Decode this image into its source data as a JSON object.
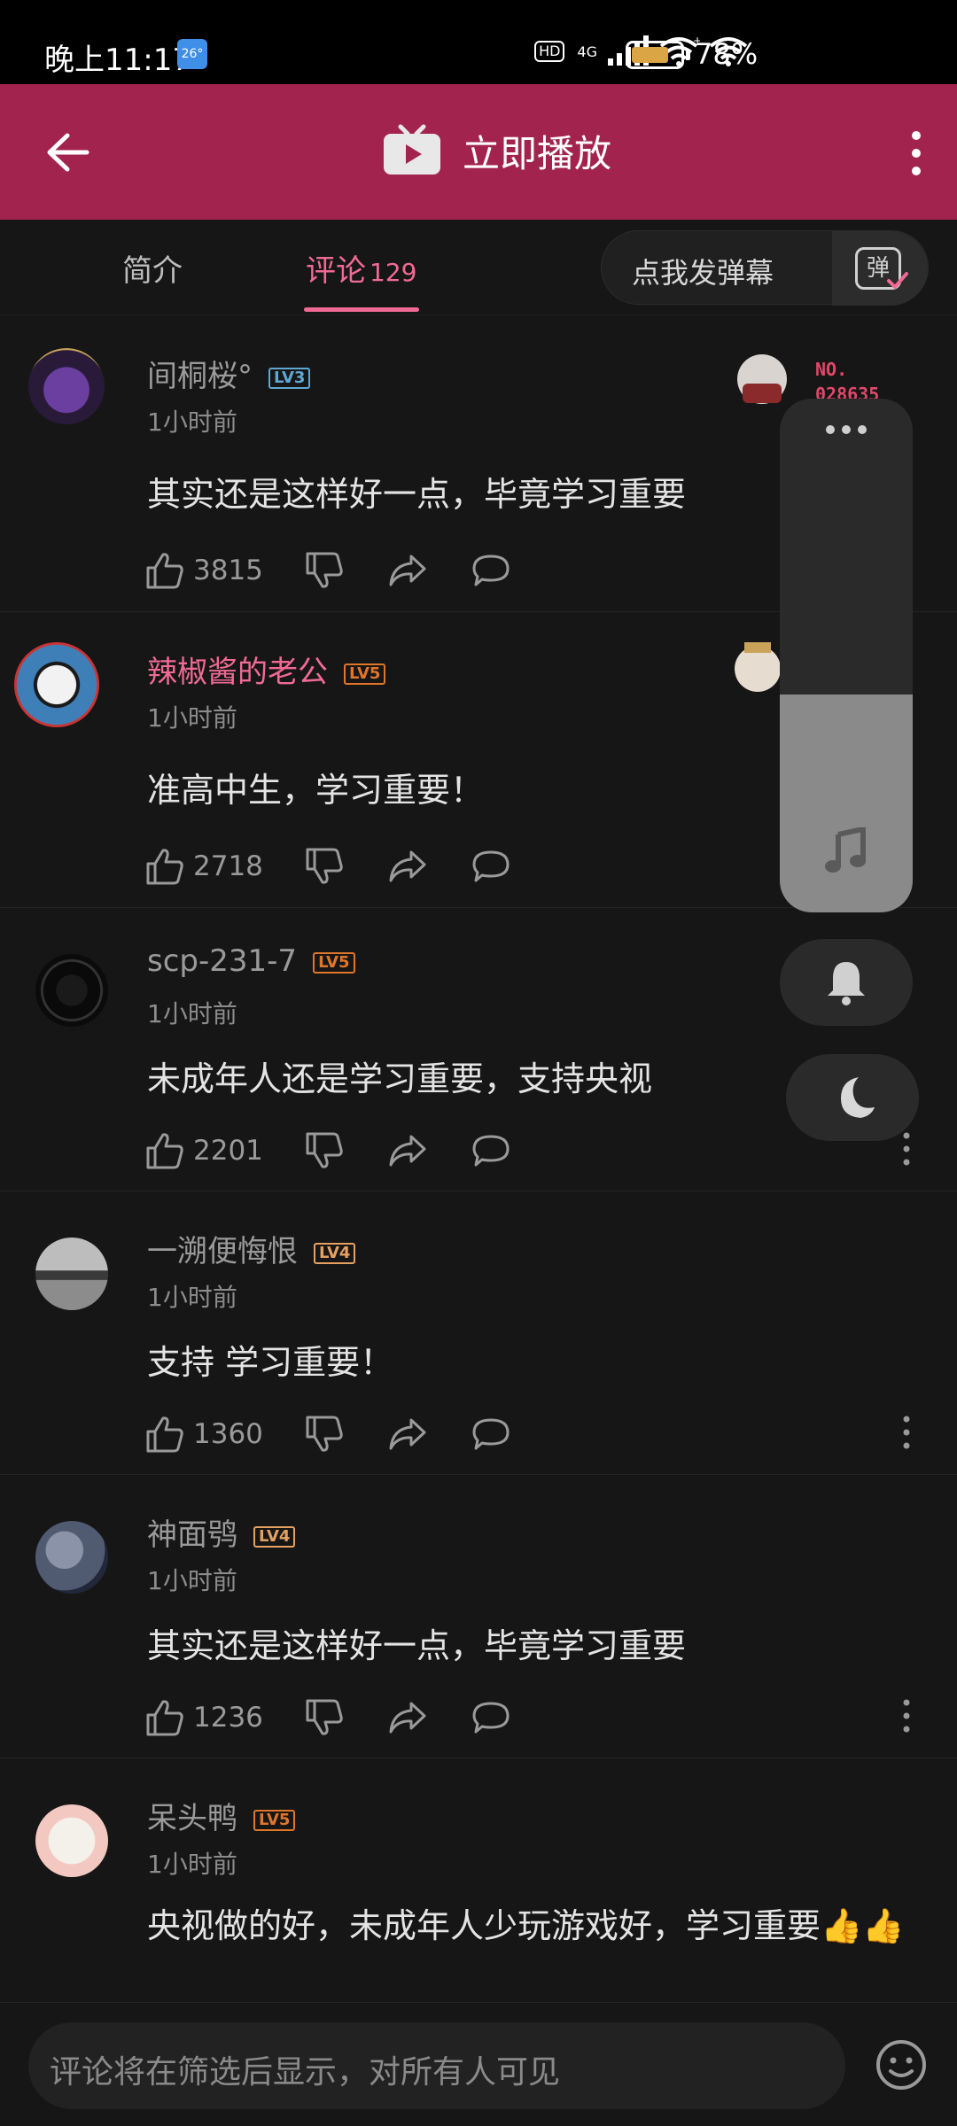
{
  "status": {
    "time": "晚上11:17",
    "weather_temp": "26°",
    "hd": "HD",
    "network": "4G",
    "battery": "78%",
    "battery_level": 0.78
  },
  "header": {
    "play_label": "立即播放"
  },
  "tabs": {
    "intro": "简介",
    "comments": "评论",
    "comment_count": "129",
    "danmaku_label": "点我发弹幕",
    "danmaku_icon_text": "弹"
  },
  "comments": [
    {
      "user": "间桐桜°",
      "level": "LV3",
      "level_color": "#5fa8d3",
      "time": "1小时前",
      "text": "其实还是这样好一点，毕竟学习重要",
      "likes": "3815",
      "fan_no": "NO.",
      "fan_id": "028635"
    },
    {
      "user": "辣椒酱的老公",
      "level": "LV5",
      "level_color": "#e0762a",
      "time": "1小时前",
      "text": "准高中生，学习重要！",
      "likes": "2718"
    },
    {
      "user": "scp-231-7",
      "level": "LV5",
      "level_color": "#e0762a",
      "time": "1小时前",
      "text": "未成年人还是学习重要，支持央视",
      "likes": "2201"
    },
    {
      "user": "一溯便悔恨",
      "level": "LV4",
      "level_color": "#e6a060",
      "time": "1小时前",
      "text": "支持 学习重要！",
      "likes": "1360"
    },
    {
      "user": "神面鸮",
      "level": "LV4",
      "level_color": "#e6a060",
      "time": "1小时前",
      "text": "其实还是这样好一点，毕竟学习重要",
      "likes": "1236"
    },
    {
      "user": "呆头鸭",
      "level": "LV5",
      "level_color": "#e0762a",
      "time": "1小时前",
      "text": "央视做的好，未成年人少玩游戏好，学习重要👍👍"
    }
  ],
  "input": {
    "placeholder": "评论将在筛选后显示，对所有人可见"
  },
  "colors": {
    "header": "#a3234f",
    "accent": "#f06a95",
    "background": "#161616"
  }
}
